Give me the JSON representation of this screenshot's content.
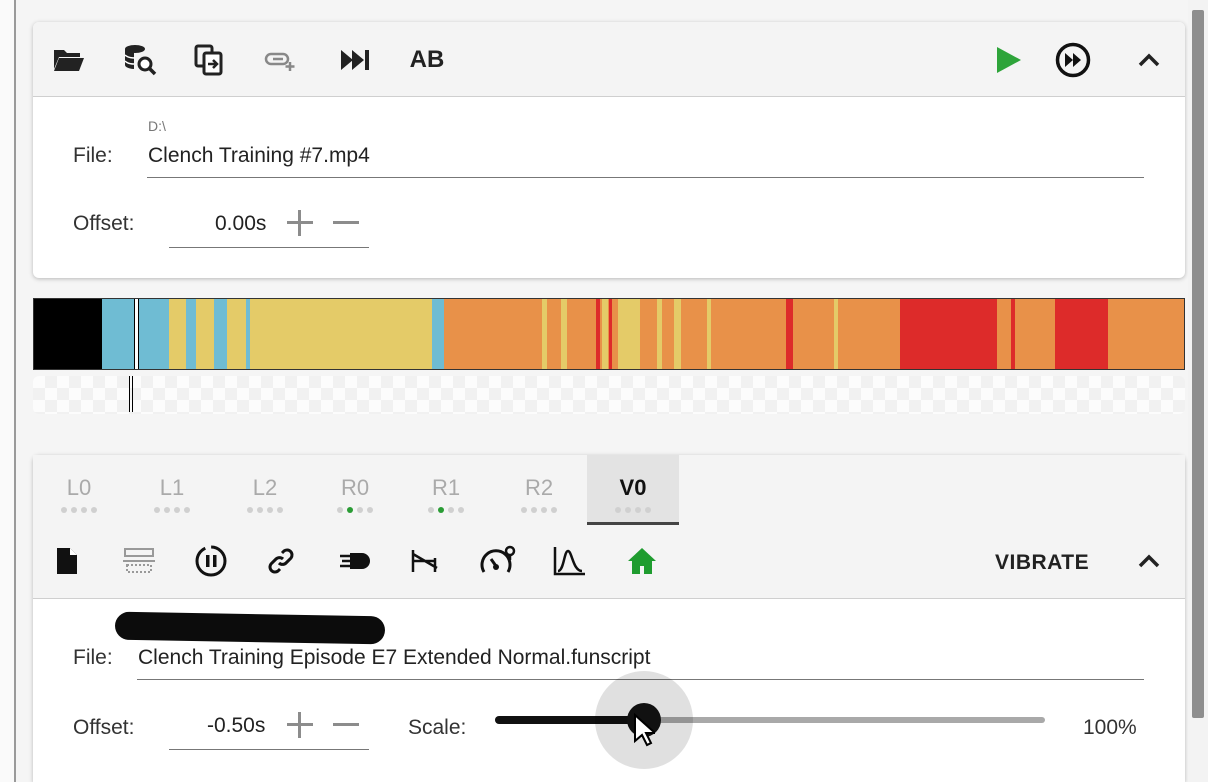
{
  "video_panel": {
    "toolbar_icons": [
      "folder-open-icon",
      "database-search-icon",
      "file-copy-icon",
      "link-add-icon",
      "skip-next-icon",
      "ab-loop"
    ],
    "ab_label": "AB",
    "right_icons": [
      "play-icon",
      "fast-forward-circle-icon",
      "chevron-up-icon"
    ],
    "file_prefix": "D:\\",
    "file_label": "File:",
    "file_name": "Clench Training #7.mp4",
    "offset_label": "Offset:",
    "offset_value": "0.00s"
  },
  "heatmap": {
    "colors": {
      "black": "#000000",
      "blue": "#6fbcd3",
      "yellow": "#e4cb68",
      "orange": "#e89149",
      "red": "#dd2b2a"
    }
  },
  "script_panel": {
    "tabs": [
      {
        "label": "L0",
        "dots": [
          0,
          0,
          0,
          0
        ]
      },
      {
        "label": "L1",
        "dots": [
          0,
          0,
          0,
          0
        ]
      },
      {
        "label": "L2",
        "dots": [
          0,
          0,
          0,
          0
        ]
      },
      {
        "label": "R0",
        "dots": [
          0,
          1,
          0,
          0
        ]
      },
      {
        "label": "R1",
        "dots": [
          0,
          1,
          0,
          0
        ]
      },
      {
        "label": "R2",
        "dots": [
          0,
          0,
          0,
          0
        ]
      },
      {
        "label": "V0",
        "dots": [
          0,
          0,
          0,
          0
        ],
        "active": true
      }
    ],
    "toolbar_icons": [
      "file-icon",
      "align-icon",
      "pause-circle-icon",
      "link-icon",
      "motor-icon",
      "wave-connector-icon",
      "speedometer-icon",
      "curve-icon",
      "home-icon"
    ],
    "mode_label": "VIBRATE",
    "file_label": "File:",
    "file_name": "Clench Training Episode E7 Extended Normal.funscript",
    "offset_label": "Offset:",
    "offset_value": "-0.50s",
    "scale_label": "Scale:",
    "scale_value": "100%",
    "scale_slider_fraction": 0.27
  },
  "accent": {
    "play_green": "#2ea43a",
    "home_green": "#1f9c2f"
  }
}
